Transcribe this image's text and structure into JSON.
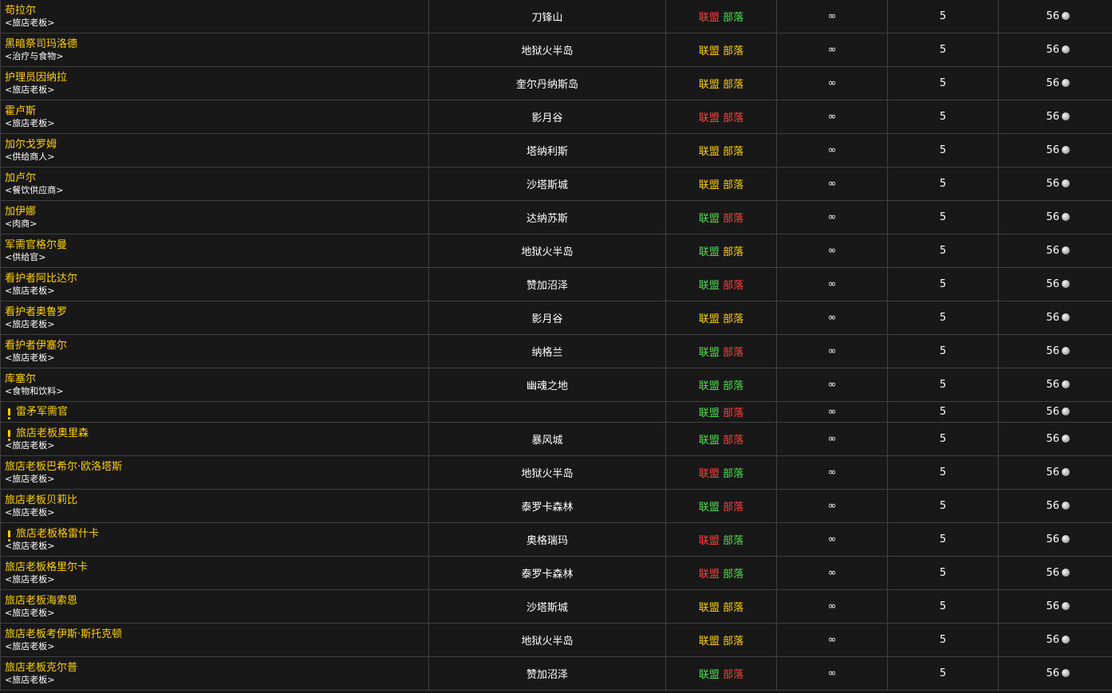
{
  "colors": {
    "red": "#ff4040",
    "yellow": "#ffd100",
    "green": "#4fe04f",
    "name": "#ffd100"
  },
  "rows": [
    {
      "name": "苟拉尔",
      "subtitle": "<旅店老板>",
      "zone": "刀锋山",
      "quest": false,
      "alliance": "联盟",
      "horde": "部落",
      "alliance_color": "red",
      "horde_color": "green",
      "stock": "∞",
      "qty": "5",
      "cost": "56"
    },
    {
      "name": "黑暗祭司玛洛德",
      "subtitle": "<治疗与食物>",
      "zone": "地狱火半岛",
      "quest": false,
      "alliance": "联盟",
      "horde": "部落",
      "alliance_color": "yellow",
      "horde_color": "yellow",
      "stock": "∞",
      "qty": "5",
      "cost": "56"
    },
    {
      "name": "护理员因纳拉",
      "subtitle": "<旅店老板>",
      "zone": "奎尔丹纳斯岛",
      "quest": false,
      "alliance": "联盟",
      "horde": "部落",
      "alliance_color": "yellow",
      "horde_color": "yellow",
      "stock": "∞",
      "qty": "5",
      "cost": "56"
    },
    {
      "name": "霍卢斯",
      "subtitle": "<旅店老板>",
      "zone": "影月谷",
      "quest": false,
      "alliance": "联盟",
      "horde": "部落",
      "alliance_color": "red",
      "horde_color": "red",
      "stock": "∞",
      "qty": "5",
      "cost": "56"
    },
    {
      "name": "加尔戈罗姆",
      "subtitle": "<供给商人>",
      "zone": "塔纳利斯",
      "quest": false,
      "alliance": "联盟",
      "horde": "部落",
      "alliance_color": "yellow",
      "horde_color": "yellow",
      "stock": "∞",
      "qty": "5",
      "cost": "56"
    },
    {
      "name": "加卢尔",
      "subtitle": "<餐饮供应商>",
      "zone": "沙塔斯城",
      "quest": false,
      "alliance": "联盟",
      "horde": "部落",
      "alliance_color": "yellow",
      "horde_color": "yellow",
      "stock": "∞",
      "qty": "5",
      "cost": "56"
    },
    {
      "name": "加伊娜",
      "subtitle": "<肉商>",
      "zone": "达纳苏斯",
      "quest": false,
      "alliance": "联盟",
      "horde": "部落",
      "alliance_color": "green",
      "horde_color": "red",
      "stock": "∞",
      "qty": "5",
      "cost": "56"
    },
    {
      "name": "军需官格尔曼",
      "subtitle": "<供给官>",
      "zone": "地狱火半岛",
      "quest": false,
      "alliance": "联盟",
      "horde": "部落",
      "alliance_color": "green",
      "horde_color": "yellow",
      "stock": "∞",
      "qty": "5",
      "cost": "56"
    },
    {
      "name": "看护者阿比达尔",
      "subtitle": "<旅店老板>",
      "zone": "赞加沼泽",
      "quest": false,
      "alliance": "联盟",
      "horde": "部落",
      "alliance_color": "green",
      "horde_color": "red",
      "stock": "∞",
      "qty": "5",
      "cost": "56"
    },
    {
      "name": "看护者奥鲁罗",
      "subtitle": "<旅店老板>",
      "zone": "影月谷",
      "quest": false,
      "alliance": "联盟",
      "horde": "部落",
      "alliance_color": "yellow",
      "horde_color": "yellow",
      "stock": "∞",
      "qty": "5",
      "cost": "56"
    },
    {
      "name": "看护者伊塞尔",
      "subtitle": "<旅店老板>",
      "zone": "纳格兰",
      "quest": false,
      "alliance": "联盟",
      "horde": "部落",
      "alliance_color": "green",
      "horde_color": "red",
      "stock": "∞",
      "qty": "5",
      "cost": "56"
    },
    {
      "name": "库塞尔",
      "subtitle": "<食物和饮料>",
      "zone": "幽魂之地",
      "quest": false,
      "alliance": "联盟",
      "horde": "部落",
      "alliance_color": "green",
      "horde_color": "green",
      "stock": "∞",
      "qty": "5",
      "cost": "56"
    },
    {
      "name": "雷矛军需官",
      "subtitle": "",
      "zone": "",
      "quest": true,
      "alliance": "联盟",
      "horde": "部落",
      "alliance_color": "green",
      "horde_color": "red",
      "stock": "∞",
      "qty": "5",
      "cost": "56"
    },
    {
      "name": "旅店老板奥里森",
      "subtitle": "<旅店老板>",
      "zone": "暴风城",
      "quest": true,
      "alliance": "联盟",
      "horde": "部落",
      "alliance_color": "green",
      "horde_color": "red",
      "stock": "∞",
      "qty": "5",
      "cost": "56"
    },
    {
      "name": "旅店老板巴希尔·欧洛塔斯",
      "subtitle": "<旅店老板>",
      "zone": "地狱火半岛",
      "quest": false,
      "alliance": "联盟",
      "horde": "部落",
      "alliance_color": "red",
      "horde_color": "green",
      "stock": "∞",
      "qty": "5",
      "cost": "56"
    },
    {
      "name": "旅店老板贝莉比",
      "subtitle": "<旅店老板>",
      "zone": "泰罗卡森林",
      "quest": false,
      "alliance": "联盟",
      "horde": "部落",
      "alliance_color": "green",
      "horde_color": "red",
      "stock": "∞",
      "qty": "5",
      "cost": "56"
    },
    {
      "name": "旅店老板格雷什卡",
      "subtitle": "<旅店老板>",
      "zone": "奥格瑞玛",
      "quest": true,
      "alliance": "联盟",
      "horde": "部落",
      "alliance_color": "red",
      "horde_color": "green",
      "stock": "∞",
      "qty": "5",
      "cost": "56"
    },
    {
      "name": "旅店老板格里尔卡",
      "subtitle": "<旅店老板>",
      "zone": "泰罗卡森林",
      "quest": false,
      "alliance": "联盟",
      "horde": "部落",
      "alliance_color": "red",
      "horde_color": "green",
      "stock": "∞",
      "qty": "5",
      "cost": "56"
    },
    {
      "name": "旅店老板海索恩",
      "subtitle": "<旅店老板>",
      "zone": "沙塔斯城",
      "quest": false,
      "alliance": "联盟",
      "horde": "部落",
      "alliance_color": "yellow",
      "horde_color": "yellow",
      "stock": "∞",
      "qty": "5",
      "cost": "56"
    },
    {
      "name": "旅店老板考伊斯·斯托克顿",
      "subtitle": "<旅店老板>",
      "zone": "地狱火半岛",
      "quest": false,
      "alliance": "联盟",
      "horde": "部落",
      "alliance_color": "yellow",
      "horde_color": "yellow",
      "stock": "∞",
      "qty": "5",
      "cost": "56"
    },
    {
      "name": "旅店老板克尔普",
      "subtitle": "<旅店老板>",
      "zone": "赞加沼泽",
      "quest": false,
      "alliance": "联盟",
      "horde": "部落",
      "alliance_color": "green",
      "horde_color": "red",
      "stock": "∞",
      "qty": "5",
      "cost": "56"
    }
  ]
}
